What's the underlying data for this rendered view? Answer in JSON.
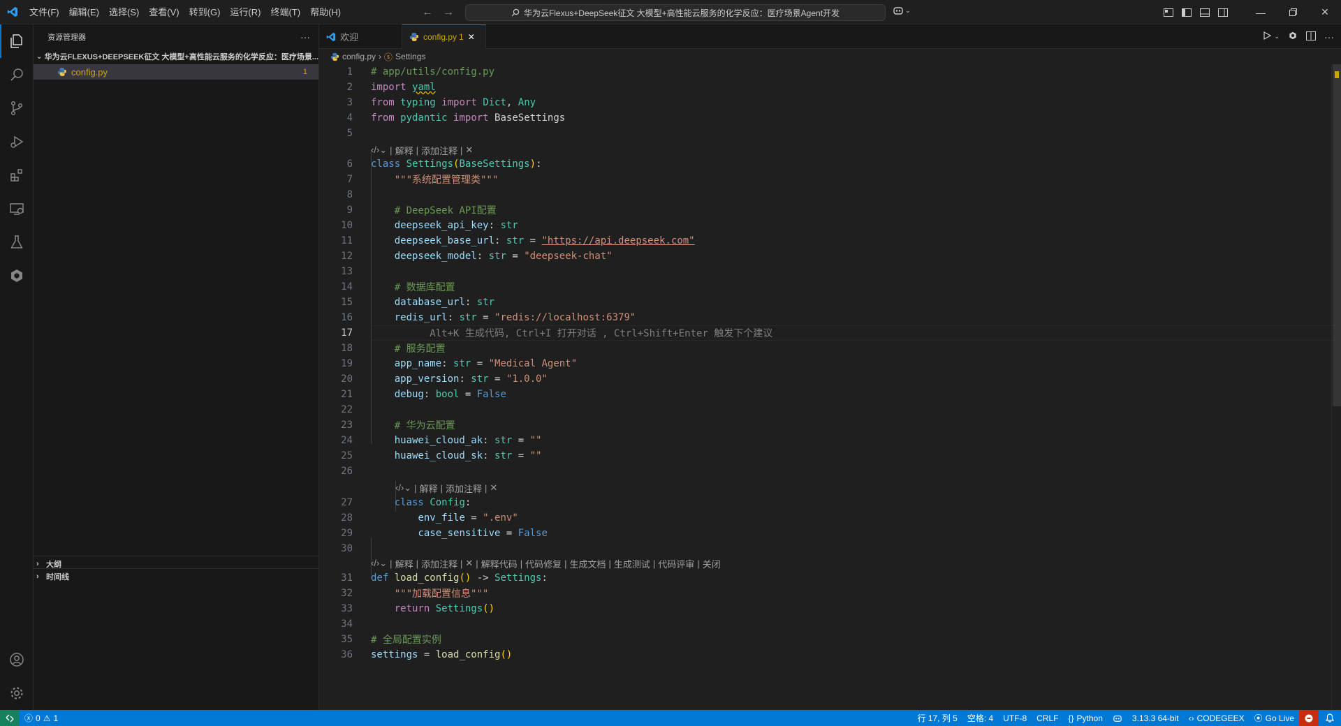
{
  "menu": [
    "文件(F)",
    "编辑(E)",
    "选择(S)",
    "查看(V)",
    "转到(G)",
    "运行(R)",
    "终端(T)",
    "帮助(H)"
  ],
  "command_center": "华为云Flexus+DeepSeek征文 大模型+高性能云服务的化学反应：医疗场景Agent开发",
  "sidebar": {
    "title": "资源管理器",
    "more": "···",
    "folder": "华为云FLEXUS+DEEPSEEK征文 大模型+高性能云服务的化学反应：医疗场景...",
    "file": {
      "name": "config.py",
      "problems": "1"
    },
    "outline": "大纲",
    "timeline": "时间线"
  },
  "tabs": [
    {
      "label": "欢迎"
    },
    {
      "label": "config.py",
      "badge": "1"
    }
  ],
  "breadcrumb": {
    "file": "config.py",
    "symbol": "Settings"
  },
  "codelens": {
    "short": [
      "解释",
      "添加注释"
    ],
    "long": [
      "解释",
      "添加注释",
      "解释代码",
      "代码修复",
      "生成文档",
      "生成测试",
      "代码评审",
      "关闭"
    ]
  },
  "ghost_hint": "Alt+K 生成代码, Ctrl+I 打开对话 , Ctrl+Shift+Enter 触发下个建议",
  "line_numbers": [
    "1",
    "2",
    "3",
    "4",
    "5",
    "6",
    "7",
    "8",
    "9",
    "10",
    "11",
    "12",
    "13",
    "14",
    "15",
    "16",
    "17",
    "18",
    "19",
    "20",
    "21",
    "22",
    "23",
    "24",
    "25",
    "26",
    "27",
    "28",
    "29",
    "30",
    "31",
    "32",
    "33",
    "34",
    "35",
    "36"
  ],
  "code": {
    "l1": "# app/utils/config.py",
    "l2a": "import",
    "l2b": "yaml",
    "l3a": "from",
    "l3b": "typing",
    "l3c": "import",
    "l3d": "Dict",
    "l3e": "Any",
    "l4a": "from",
    "l4b": "pydantic",
    "l4c": "import",
    "l4d": "BaseSettings",
    "l6a": "class",
    "l6b": "Settings",
    "l6c": "BaseSettings",
    "l7": "\"\"\"系统配置管理类\"\"\"",
    "l9": "# DeepSeek API配置",
    "l10a": "deepseek_api_key",
    "l10b": "str",
    "l11a": "deepseek_base_url",
    "l11b": "str",
    "l11c": "\"https://api.deepseek.com\"",
    "l12a": "deepseek_model",
    "l12b": "str",
    "l12c": "\"deepseek-chat\"",
    "l14": "# 数据库配置",
    "l15a": "database_url",
    "l15b": "str",
    "l16a": "redis_url",
    "l16b": "str",
    "l16c": "\"redis://localhost:6379\"",
    "l18": "# 服务配置",
    "l19a": "app_name",
    "l19b": "str",
    "l19c": "\"Medical Agent\"",
    "l20a": "app_version",
    "l20b": "str",
    "l20c": "\"1.0.0\"",
    "l21a": "debug",
    "l21b": "bool",
    "l21c": "False",
    "l23": "# 华为云配置",
    "l24a": "huawei_cloud_ak",
    "l24b": "str",
    "l24c": "\"\"",
    "l25a": "huawei_cloud_sk",
    "l25b": "str",
    "l25c": "\"\"",
    "l27a": "class",
    "l27b": "Config",
    "l28a": "env_file",
    "l28b": "\".env\"",
    "l29a": "case_sensitive",
    "l29b": "False",
    "l31a": "def",
    "l31b": "load_config",
    "l31c": "Settings",
    "l32": "\"\"\"加载配置信息\"\"\"",
    "l33a": "return",
    "l33b": "Settings",
    "l35": "# 全局配置实例",
    "l36a": "settings",
    "l36b": "load_config"
  },
  "status": {
    "errors": "0",
    "warnings": "1",
    "position": "行 17, 列 5",
    "spaces": "空格: 4",
    "encoding": "UTF-8",
    "eol": "CRLF",
    "language": "Python",
    "interpreter": "3.13.3 64-bit",
    "codegeex": "CODEGEEX",
    "golive": "Go Live"
  },
  "colors": {
    "accent": "#0078d4",
    "modified": "#cca700",
    "remote": "#16825d"
  }
}
